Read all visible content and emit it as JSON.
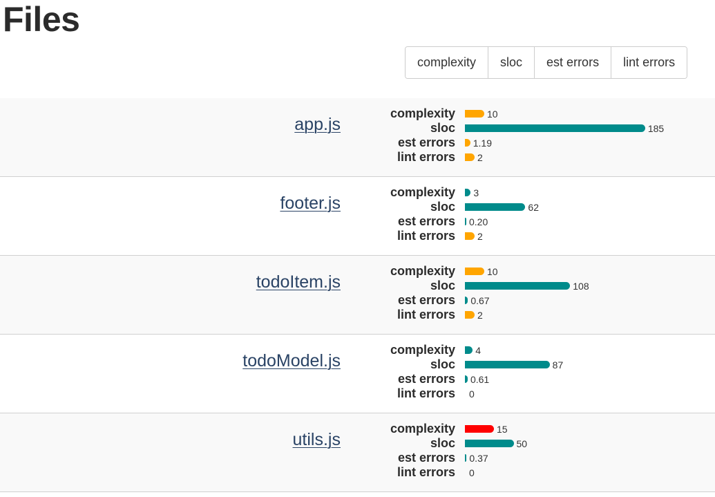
{
  "page": {
    "title": "Files"
  },
  "toolbar": {
    "buttons": [
      {
        "label": "complexity"
      },
      {
        "label": "sloc"
      },
      {
        "label": "est errors"
      },
      {
        "label": "lint errors"
      }
    ]
  },
  "colors": {
    "ok": "#008b8b",
    "warning": "#ffa500",
    "danger": "#ff0000",
    "link": "#2a4365"
  },
  "metric_labels": {
    "complexity": "complexity",
    "sloc": "sloc",
    "est_errors": "est errors",
    "lint_errors": "lint errors"
  },
  "files": [
    {
      "name": "app.js",
      "metrics": [
        {
          "key": "complexity",
          "value": 10,
          "display": "10",
          "status": "warning"
        },
        {
          "key": "sloc",
          "value": 185,
          "display": "185",
          "status": "ok"
        },
        {
          "key": "est_errors",
          "value": 1.19,
          "display": "1.19",
          "status": "warning"
        },
        {
          "key": "lint_errors",
          "value": 2,
          "display": "2",
          "status": "warning"
        }
      ]
    },
    {
      "name": "footer.js",
      "metrics": [
        {
          "key": "complexity",
          "value": 3,
          "display": "3",
          "status": "ok"
        },
        {
          "key": "sloc",
          "value": 62,
          "display": "62",
          "status": "ok"
        },
        {
          "key": "est_errors",
          "value": 0.2,
          "display": "0.20",
          "status": "ok"
        },
        {
          "key": "lint_errors",
          "value": 2,
          "display": "2",
          "status": "warning"
        }
      ]
    },
    {
      "name": "todoItem.js",
      "metrics": [
        {
          "key": "complexity",
          "value": 10,
          "display": "10",
          "status": "warning"
        },
        {
          "key": "sloc",
          "value": 108,
          "display": "108",
          "status": "ok"
        },
        {
          "key": "est_errors",
          "value": 0.67,
          "display": "0.67",
          "status": "ok"
        },
        {
          "key": "lint_errors",
          "value": 2,
          "display": "2",
          "status": "warning"
        }
      ]
    },
    {
      "name": "todoModel.js",
      "metrics": [
        {
          "key": "complexity",
          "value": 4,
          "display": "4",
          "status": "ok"
        },
        {
          "key": "sloc",
          "value": 87,
          "display": "87",
          "status": "ok"
        },
        {
          "key": "est_errors",
          "value": 0.61,
          "display": "0.61",
          "status": "ok"
        },
        {
          "key": "lint_errors",
          "value": 0,
          "display": "0",
          "status": "ok"
        }
      ]
    },
    {
      "name": "utils.js",
      "metrics": [
        {
          "key": "complexity",
          "value": 15,
          "display": "15",
          "status": "danger"
        },
        {
          "key": "sloc",
          "value": 50,
          "display": "50",
          "status": "ok"
        },
        {
          "key": "est_errors",
          "value": 0.37,
          "display": "0.37",
          "status": "ok"
        },
        {
          "key": "lint_errors",
          "value": 0,
          "display": "0",
          "status": "ok"
        }
      ]
    }
  ]
}
